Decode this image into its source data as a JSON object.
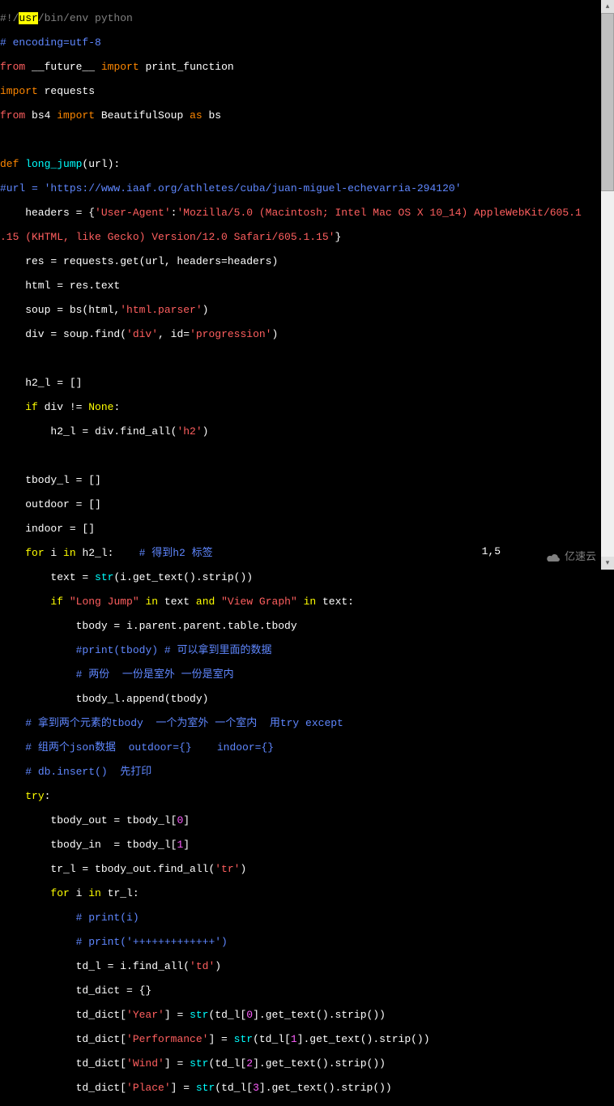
{
  "code": {
    "l1_shebang_pre": "#!/",
    "l1_shebang_hl": "usr",
    "l1_shebang_post": "/bin/env python",
    "l2": "# encoding=utf-8",
    "l3_from": "from",
    "l3_future": " __future__ ",
    "l3_import": "import",
    "l3_pf": " print_function",
    "l4_import": "import",
    "l4_req": " requests",
    "l5_from": "from",
    "l5_bs4": " bs4 ",
    "l5_import": "import",
    "l5_bs": " BeautifulSoup ",
    "l5_as": "as",
    "l5_bsa": " bs",
    "l7_def": "def",
    "l7_fn": " long_jump",
    "l7_after": "(url):",
    "l8_comment": "#url = 'https://www.iaaf.org/athletes/cuba/juan-miguel-echevarria-294120'",
    "l9_pre": "    headers = {",
    "l9_k": "'User-Agent'",
    "l9_colon": ":",
    "l9_v": "'Mozilla/5.0 (Macintosh; Intel Mac OS X 10_14) AppleWebKit/605.1",
    "l10_v": ".15 (KHTML, like Gecko) Version/12.0 Safari/605.1.15'",
    "l10_after": "}",
    "l11": "    res = requests.get(url, headers=headers)",
    "l12": "    html = res.text",
    "l13_pre": "    soup = bs(html,",
    "l13_str": "'html.parser'",
    "l13_after": ")",
    "l14_pre": "    div = soup.find(",
    "l14_s1": "'div'",
    "l14_mid": ", id=",
    "l14_s2": "'progression'",
    "l14_after": ")",
    "l16": "    h2_l = []",
    "l17_pre": "    ",
    "l17_if": "if",
    "l17_mid": " div != ",
    "l17_none": "None",
    "l17_after": ":",
    "l18_pre": "        h2_l = div.find_all(",
    "l18_str": "'h2'",
    "l18_after": ")",
    "l20": "    tbody_l = []",
    "l21": "    outdoor = []",
    "l22": "    indoor = []",
    "l23_pre": "    ",
    "l23_for": "for",
    "l23_i": " i ",
    "l23_in": "in",
    "l23_mid": " h2_l:    ",
    "l23_comment": "# 得到h2 标签",
    "l24_pre": "        text = ",
    "l24_str": "str",
    "l24_after": "(i.get_text().strip())",
    "l25_pre": "        ",
    "l25_if": "if",
    "l25_sp": " ",
    "l25_s1": "\"Long Jump\"",
    "l25_sp2": " ",
    "l25_in1": "in",
    "l25_txt": " text ",
    "l25_and": "and",
    "l25_sp3": " ",
    "l25_s2": "\"View Graph\"",
    "l25_sp4": " ",
    "l25_in2": "in",
    "l25_after": " text:",
    "l26": "            tbody = i.parent.parent.table.tbody",
    "l27_pre": "            ",
    "l27_comment": "#print(tbody) # 可以拿到里面的数据",
    "l28_pre": "            ",
    "l28_comment": "# 两份  一份是室外 一份是室内",
    "l29": "            tbody_l.append(tbody)",
    "l30_pre": "    ",
    "l30_comment": "# 拿到两个元素的tbody  一个为室外 一个室内  用try except",
    "l31_pre": "    ",
    "l31_comment": "# 组两个json数据  outdoor={}    indoor={}",
    "l32_pre": "    ",
    "l32_comment": "# db.insert()  先打印",
    "l33_pre": "    ",
    "l33_try": "try",
    "l33_after": ":",
    "l34_pre": "        tbody_out = tbody_l[",
    "l34_n": "0",
    "l34_after": "]",
    "l35_pre": "        tbody_in  = tbody_l[",
    "l35_n": "1",
    "l35_after": "]",
    "l36_pre": "        tr_l = tbody_out.find_all(",
    "l36_str": "'tr'",
    "l36_after": ")",
    "l37_pre": "        ",
    "l37_for": "for",
    "l37_i": " i ",
    "l37_in": "in",
    "l37_after": " tr_l:",
    "l38_pre": "            ",
    "l38_comment": "# print(i)",
    "l39_pre": "            ",
    "l39_comment": "# print('+++++++++++++')",
    "l40_pre": "            td_l = i.find_all(",
    "l40_str": "'td'",
    "l40_after": ")",
    "l41": "            td_dict = {}",
    "l42_pre": "            td_dict[",
    "l42_k": "'Year'",
    "l42_mid": "] = ",
    "l42_str": "str",
    "l42_a2": "(td_l[",
    "l42_n": "0",
    "l42_after": "].get_text().strip())",
    "l43_pre": "            td_dict[",
    "l43_k": "'Performance'",
    "l43_mid": "] = ",
    "l43_str": "str",
    "l43_a2": "(td_l[",
    "l43_n": "1",
    "l43_after": "].get_text().strip())",
    "l44_pre": "            td_dict[",
    "l44_k": "'Wind'",
    "l44_mid": "] = ",
    "l44_str": "str",
    "l44_a2": "(td_l[",
    "l44_n": "2",
    "l44_after": "].get_text().strip())",
    "l45_pre": "            td_dict[",
    "l45_k": "'Place'",
    "l45_mid": "] = ",
    "l45_str": "str",
    "l45_a2": "(td_l[",
    "l45_n": "3",
    "l45_after": "].get_text().strip())"
  },
  "status": {
    "position": "1,5"
  },
  "watermark": {
    "text": "亿速云"
  }
}
